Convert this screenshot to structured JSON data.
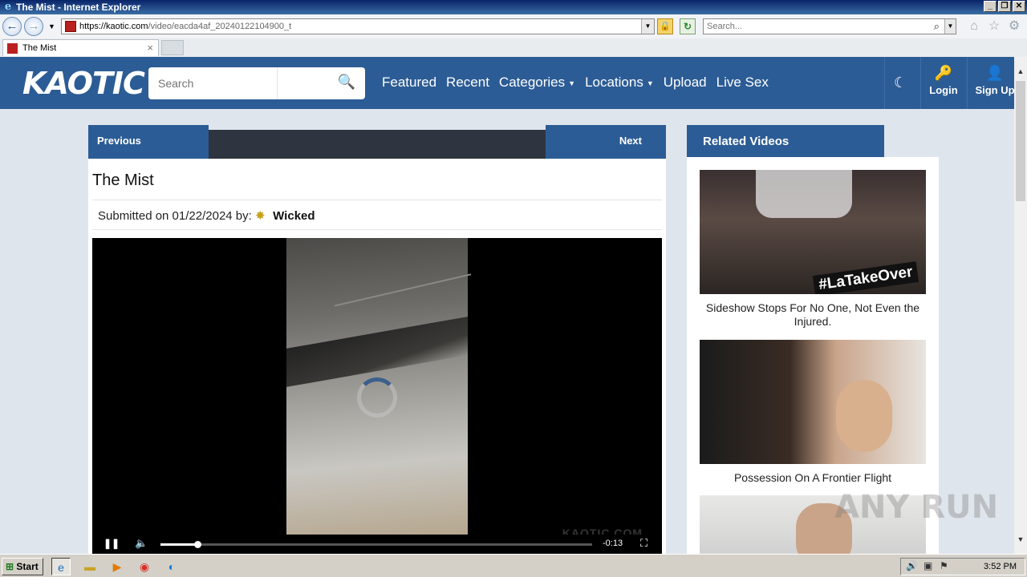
{
  "window": {
    "title": "The Mist - Internet Explorer",
    "controls": [
      "_",
      "❐",
      "✕"
    ]
  },
  "browser": {
    "url_host": "https://kaotic.com",
    "url_path": "/video/eacda4af_20240122104900_t",
    "search_placeholder": "Search...",
    "tab_label": "The Mist"
  },
  "site": {
    "logo": "KAOTIC",
    "search_placeholder": "Search",
    "nav": [
      {
        "label": "Featured"
      },
      {
        "label": "Recent"
      },
      {
        "label": "Categories",
        "caret": true
      },
      {
        "label": "Locations",
        "caret": true
      },
      {
        "label": "Upload"
      },
      {
        "label": "Live Sex"
      }
    ],
    "login_label": "Login",
    "signup_label": "Sign Up"
  },
  "video": {
    "previous_label": "Previous",
    "next_label": "Next",
    "title": "The Mist",
    "submitted_text": "Submitted on 01/22/2024 by:",
    "author": "Wicked",
    "watermark": "KAOTIC.COM",
    "time_remaining": "-0:13",
    "progress_fraction": 0.085
  },
  "related": {
    "heading": "Related Videos",
    "items": [
      {
        "title": "Sideshow Stops For No One, Not Even the Injured.",
        "thumb_tag": "#LaTakeOver"
      },
      {
        "title": "Possession On A Frontier Flight"
      },
      {
        "title": ""
      }
    ]
  },
  "overlay": {
    "anyrun": "ANY RUN"
  },
  "taskbar": {
    "start_label": "Start",
    "clock": "3:52 PM"
  },
  "colors": {
    "brand": "#2c5c95",
    "page_bg": "#dfe5ec"
  }
}
